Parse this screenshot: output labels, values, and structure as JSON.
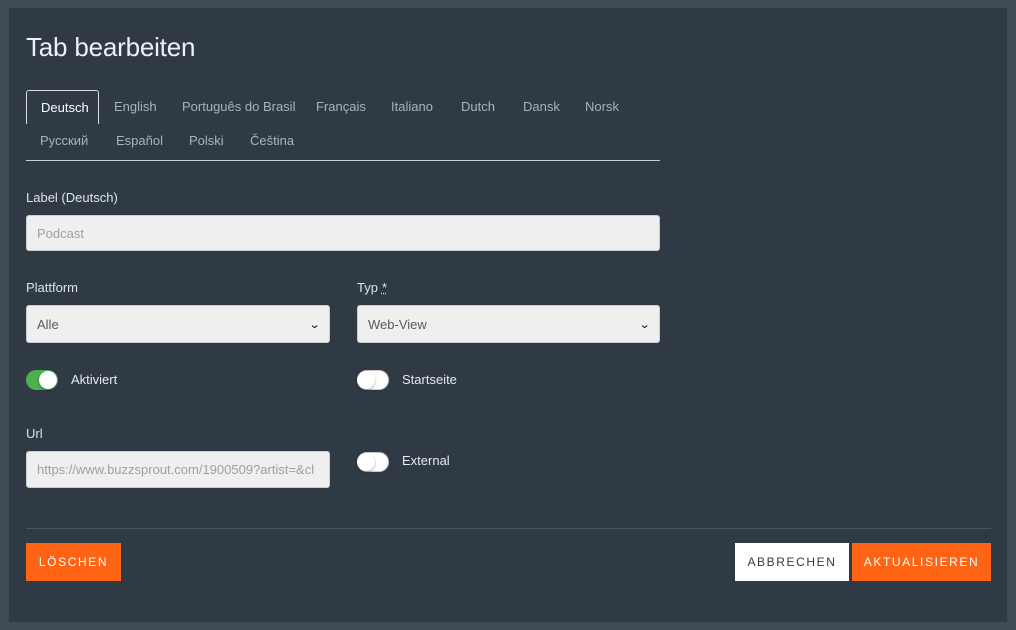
{
  "dialog": {
    "title": "Tab bearbeiten",
    "language_tabs": [
      "Deutsch",
      "English",
      "Português do Brasil",
      "Français",
      "Italiano",
      "Dutch",
      "Dansk",
      "Norsk",
      "Русский",
      "Español",
      "Polski",
      "Čeština"
    ],
    "active_tab": "Deutsch",
    "label_field": {
      "label": "Label (Deutsch)",
      "placeholder": "Podcast",
      "value": ""
    },
    "platform_field": {
      "label": "Plattform",
      "value": "Alle"
    },
    "type_field": {
      "label": "Typ",
      "required_marker": "*",
      "value": "Web-View"
    },
    "toggles": {
      "activated": {
        "label": "Aktiviert",
        "on": true
      },
      "startpage": {
        "label": "Startseite",
        "on": false
      },
      "external": {
        "label": "External",
        "on": false
      }
    },
    "url_field": {
      "label": "Url",
      "value": "https://www.buzzsprout.com/1900509?artist=&cl"
    },
    "buttons": {
      "delete": "LÖSCHEN",
      "cancel": "ABBRECHEN",
      "update": "AKTUALISIEREN"
    }
  },
  "colors": {
    "accent": "#ff6314",
    "toggle_on": "#4caf50",
    "background": "#2f3a45"
  }
}
